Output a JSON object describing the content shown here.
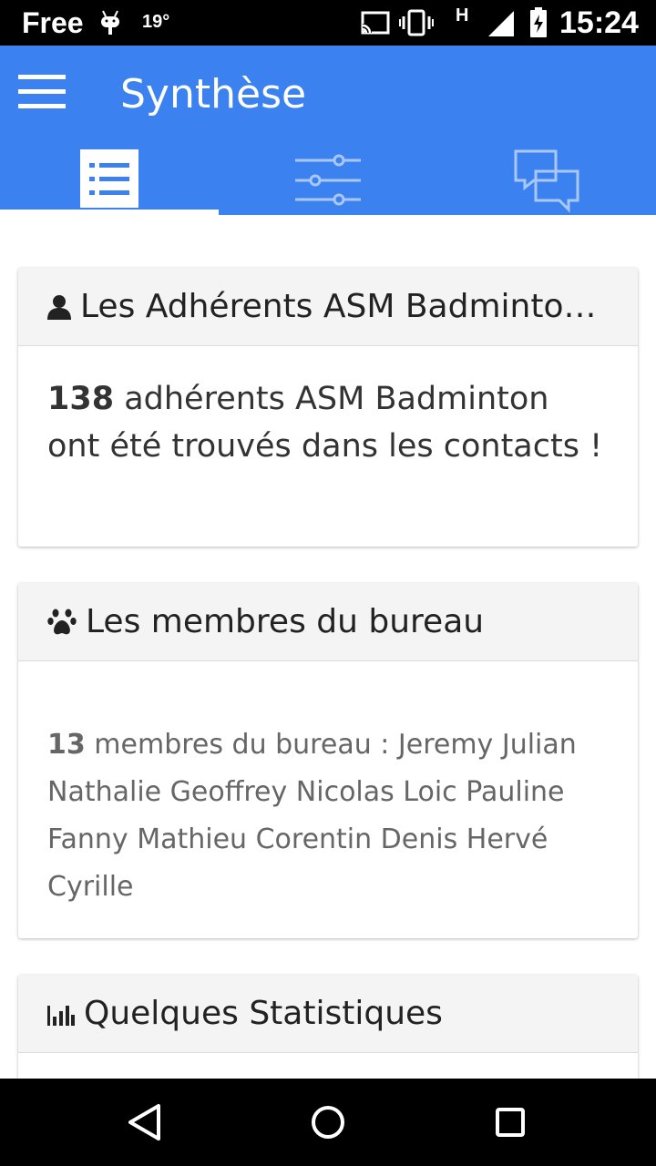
{
  "status_bar": {
    "carrier": "Free",
    "temperature": "19°",
    "network_type": "H",
    "time": "15:24",
    "icons": [
      "android-icon",
      "cast-icon",
      "vibrate-icon",
      "signal-icon",
      "battery-charging-icon"
    ]
  },
  "app_bar": {
    "title": "Synthèse",
    "background_color": "#3b82f0",
    "tabs": [
      {
        "icon": "list-icon",
        "selected": true
      },
      {
        "icon": "sliders-icon",
        "selected": false
      },
      {
        "icon": "chat-bubbles-icon",
        "selected": false
      }
    ]
  },
  "cards": {
    "adherents": {
      "icon": "user-icon",
      "title": "Les Adhérents ASM Badmintoـ",
      "title_full": "Les Adhérents ASM Badminto…",
      "count": "138",
      "text": " adhérents ASM Badminton ont été trouvés dans les contacts !"
    },
    "bureau": {
      "icon": "paw-icon",
      "title": "Les membres du bureau",
      "count": "13",
      "text": " membres du bureau : Jeremy Julian Nathalie Geoffrey Nicolas Loic Pauline Fanny Mathieu Corentin Denis Hervé Cyrille"
    },
    "stats": {
      "icon": "bar-chart-icon",
      "title": "Quelques Statistiques"
    }
  },
  "nav_bar": {
    "icons": [
      "back-icon",
      "home-icon",
      "recents-icon"
    ]
  }
}
